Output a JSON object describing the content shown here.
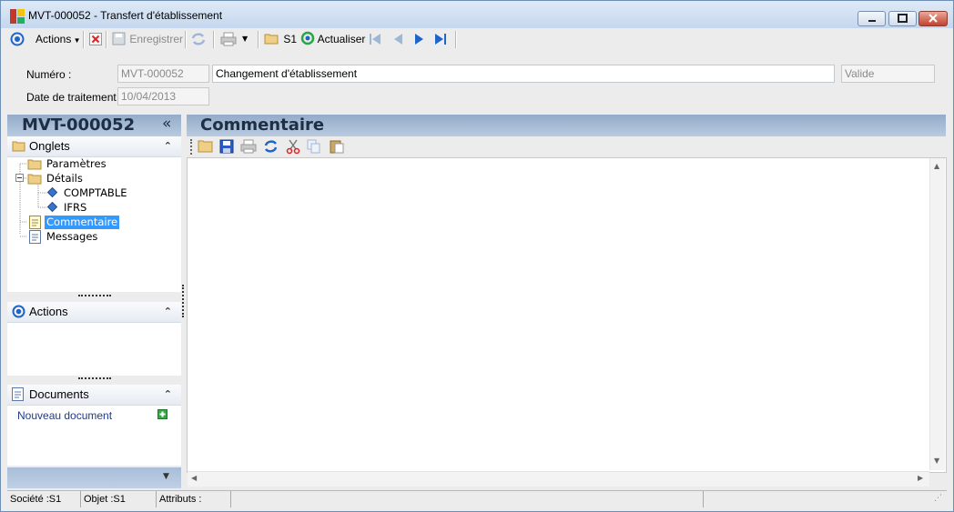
{
  "window": {
    "title": "MVT-000052 -  Transfert d'établissement"
  },
  "toolbar": {
    "actions_label": "Actions",
    "save_label": "Enregistrer",
    "s1_label": "S1",
    "refresh_label": "Actualiser"
  },
  "header": {
    "numero_label": "Numéro :",
    "numero_value": "MVT-000052",
    "description_value": "Changement d'établissement",
    "status_value": "Valide",
    "date_label": "Date de traitement :",
    "date_value": "10/04/2013"
  },
  "left_panel": {
    "title": "MVT-000052",
    "collapse_glyph": "«",
    "onglets_title": "Onglets",
    "tree": [
      {
        "label": "Paramètres",
        "icon": "folder-icon"
      },
      {
        "label": "Détails",
        "icon": "folder-icon"
      },
      {
        "label": "COMPTABLE",
        "icon": "diamond-icon"
      },
      {
        "label": "IFRS",
        "icon": "diamond-icon"
      },
      {
        "label": "Commentaire",
        "icon": "note-icon",
        "selected": true
      },
      {
        "label": "Messages",
        "icon": "document-icon"
      }
    ],
    "actions_title": "Actions",
    "documents_title": "Documents",
    "new_document_label": "Nouveau document"
  },
  "main": {
    "title": "Commentaire"
  },
  "statusbar": {
    "societe": "Société :S1",
    "objet": "Objet :S1",
    "attributs": "Attributs :"
  },
  "colors": {
    "panel_header": "#a7bdd8",
    "selection": "#3399ff",
    "accent_blue": "#1f64c8"
  }
}
